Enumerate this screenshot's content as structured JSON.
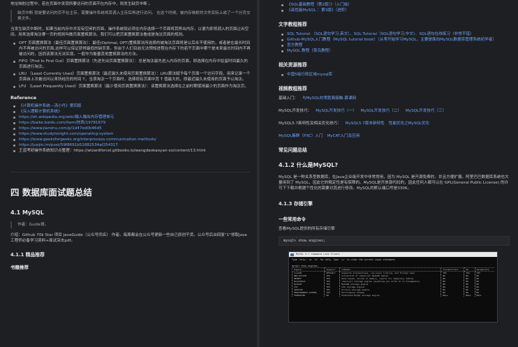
{
  "left": {
    "intro": "地址映射过程中，若在页面中发现所要访问的页面不在内存中，则发生缺页中断 。",
    "quote": "缺页中断 就是要访问的页不在主存，需要操作系统将其调入主存后再进行访问。 在这个时候，被内存映射的文件实际上成了一个分页交换文件。",
    "para": "当发生缺页中断时，如果当前内存中并没有空闲的页面，操作系统就必须在内存选择一个页面将其移出内存，以便为即将调入的页面让出空间。用来选择淘汰哪一页的规则叫做页面置换算法。我们可以把页面置换算法看成是淘汰页面的规则。",
    "algorithms": [
      "OPT 页面置换算法（最佳页面置换算法）：最佳(Optimal, OPT)置换算法所选择的被淘汰页面将是以后永不使用的，或者是在最长时间内不再被访问的页面,这样可以保证获得最低的缺页率。但由于人们目前无法预知进程在内存下的若干页面中哪个是未来最长时间内不再被访问的，因而该算法无法实现。一般作为衡量其他置换算法的方法。",
      "FIFO（First In First Out）页面置换算法（先进先出页面置换算法）：总是淘汰最先进入内存的页面，即选择在内存中驻留时间最久的页面进行淘汰。",
      "LRU （Least Currently Used）页面置换算法（最近最久未使用页面置换算法）：LRU算法赋予每个页面一个访问字段，用来记录一个页面自上次被访问以来所经历的时间 T，当须淘汰一个页面时，选择现有页面中其 T 值最大的，即最近最久未使用的页面予以淘汰。",
      "LFU （Least Frequently Used）页面置换算法（最少使用页面置换算法）：该置换算法选择在之前时期使用最少的页面作为淘汰页。"
    ],
    "reference_heading": "Reference",
    "references": [
      "《计算机操作系统—汤小丹》第四版",
      "《深入理解计算机系统》",
      "https://zh.wikipedia.org/wiki/输入输出内存管理单元",
      "https://baike.baidu.com/item/快表/19781679",
      "https://www.jianshu.com/p/1d47ed0b46d5",
      "https://www.studytonight.com/operating-system",
      "https://www.geeksforgeeks.org/interprocess-communication-methods/",
      "https://juejin.im/post/59f8691b51882534af254317",
      "王道考研操作系统知识点整理：https://wizardforcel.gitbooks.io/wangdaokaoyan-os/content/13.html"
    ],
    "section_title": "四 数据库面试题总结",
    "mysql_heading": "4.1 MySQL",
    "author_quote": "作者：Guide哥。",
    "author_intro": "介绍：Github 70k Star 项目 JavaGuide（公众号同名） 作者。每周都会在公众号更新一些自己原创干货。公众号后台回复\"1\"领取Java工程师必备学习资料+面试突击pdf。",
    "recommend_heading": "4.1.1 精品推荐",
    "book_heading": "书籍推荐"
  },
  "right": {
    "top_items": [
      "《SQL基础教程（第2版）》（入门级）",
      "《高性能MySQL ：第3版》（进阶）"
    ],
    "tutorial_heading": "文字教程推荐",
    "tutorials": [
      "SQL Tutorial （SQL语句学习,英文）、SQL Tutorial（SQL语句学习,中文）、SQL语句在线练习（非常不错）",
      "Github-MySQL入门教程（MySQL tutorial book）（从零开始学习MySQL，主要是面向MySQL数据库管理系统初学者）",
      "官方教程",
      "MySQL 教程（菜鸟教程）"
    ],
    "resource_heading": "相关资源推荐",
    "resources": [
      "中国5级行政区域mysql库"
    ],
    "video_heading": "视频教程推荐",
    "video_rows": [
      {
        "label": "基础入门：",
        "links": [
          "与MySQL的零距离接触-慕课网"
        ]
      },
      {
        "label": "MySQL开发技巧：",
        "links": [
          "MySQL开发技巧（一）",
          "MySQL开发技巧（二）",
          "MySQL开发技巧（三）"
        ]
      },
      {
        "label": "MySQL5.7新特性及相关优化技巧：",
        "links": [
          "MySQL5.7版本新特性",
          "性能优化之MySQL优化"
        ]
      },
      {
        "label": "MySQL集群（PXC）入门",
        "links": [
          "MyCAT入门及应用"
        ]
      }
    ],
    "faq_heading": "常见问题总结",
    "what_heading": "4.1.2 什么是MySQL?",
    "what_para": "MySQL 是一种关系型数据库，在Java企业级开发中非常常用，因为 MySQL 是开源免费的，并且方便扩展。阿里巴巴数据库系统也大量用到了 MySQL，因此它的稳定性是有保障的。MySQL是开放源代码的，因此任何人都可以在 GPL(General Public License) 的许可下下载并根据个性化的需要对其进行修改。MySQL的默认端口号是3306。",
    "engine_heading": "4.1.3 存储引擎",
    "cmd_heading": "一些常用命令",
    "cmd_desc": "查看MySQL提供的所有存储引擎",
    "cmd_code": "mysql> show engines;",
    "terminal": {
      "title": "MySQL 5.7 Command Line Client",
      "lines": [
        "Type 'help;' or '\\h' for help. Type '\\c' to clear the current input statement.",
        "",
        "mysql> show engines;"
      ],
      "headers": [
        "Engine",
        "Support",
        "Comment",
        "Transactions",
        "XA",
        "Savepoints"
      ],
      "rows": [
        [
          "InnoDB",
          "DEFAULT",
          "Supports transactions, row-level locking, and foreign keys",
          "YES",
          "YES",
          "YES"
        ],
        [
          "MRG_MYISAM",
          "YES",
          "Collection of identical MyISAM tables",
          "NO",
          "NO",
          "NO"
        ],
        [
          "MEMORY",
          "YES",
          "Hash based, stored in memory, useful for temporary tables",
          "NO",
          "NO",
          "NO"
        ],
        [
          "BLACKHOLE",
          "YES",
          "/dev/null storage engine (anything you write to it disappears)",
          "NO",
          "NO",
          "NO"
        ],
        [
          "MyISAM",
          "YES",
          "MyISAM storage engine",
          "NO",
          "NO",
          "NO"
        ],
        [
          "CSV",
          "YES",
          "CSV storage engine",
          "NO",
          "NO",
          "NO"
        ],
        [
          "ARCHIVE",
          "YES",
          "Archive storage engine",
          "NO",
          "NO",
          "NO"
        ],
        [
          "PERFORMANCE_SCHEMA",
          "YES",
          "Performance Schema",
          "NO",
          "NO",
          "NO"
        ],
        [
          "FEDERATED",
          "NO",
          "Federated MySQL storage engine",
          "NULL",
          "NULL",
          "NULL"
        ]
      ]
    }
  }
}
